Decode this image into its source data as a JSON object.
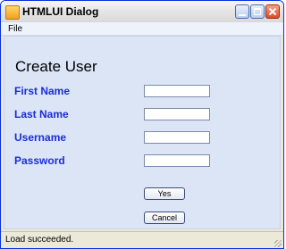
{
  "window": {
    "title": "HTMLUI Dialog",
    "icon": "app-icon"
  },
  "menu": {
    "file": "File"
  },
  "form": {
    "heading": "Create User",
    "fields": [
      {
        "label": "First Name",
        "value": ""
      },
      {
        "label": "Last Name",
        "value": ""
      },
      {
        "label": "Username",
        "value": ""
      },
      {
        "label": "Password",
        "value": ""
      }
    ]
  },
  "buttons": {
    "yes": "Yes",
    "cancel": "Cancel"
  },
  "status": {
    "text": "Load succeeded."
  },
  "colors": {
    "label": "#1b2dd6",
    "panel": "#dbe5f6"
  }
}
